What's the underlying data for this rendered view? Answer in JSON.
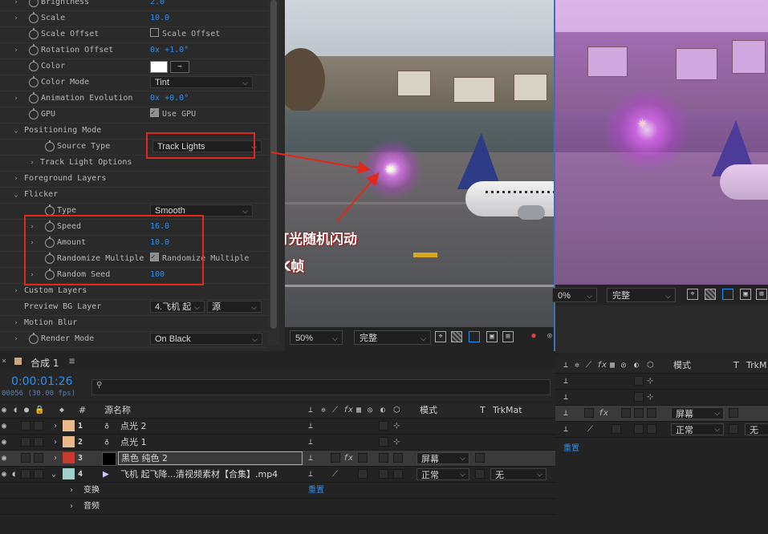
{
  "effect_controls": {
    "properties": [
      {
        "label": "Brightness",
        "value": "2.0",
        "kind": "number"
      },
      {
        "label": "Scale",
        "value": "10.0",
        "kind": "number"
      },
      {
        "label": "Scale Offset",
        "value": "Scale Offset",
        "kind": "checkbox",
        "checked": false
      },
      {
        "label": "Rotation Offset",
        "value_prefix": "0x",
        "value": "+1.0°",
        "kind": "angle"
      },
      {
        "label": "Color",
        "kind": "color",
        "color": "#ffffff"
      },
      {
        "label": "Color Mode",
        "value": "Tint",
        "kind": "dropdown"
      },
      {
        "label": "Animation Evolution",
        "value_prefix": "0x",
        "value": "+0.0°",
        "kind": "angle"
      },
      {
        "label": "GPU",
        "value": "Use GPU",
        "kind": "checkbox",
        "checked": true
      },
      {
        "label": "Positioning Mode",
        "kind": "group"
      },
      {
        "label": "Source Type",
        "value": "Track Lights",
        "kind": "dropdown"
      },
      {
        "label": "Track Light Options",
        "kind": "subgroup"
      },
      {
        "label": "Foreground Layers",
        "kind": "group"
      },
      {
        "label": "Flicker",
        "kind": "group"
      },
      {
        "label": "Type",
        "value": "Smooth",
        "kind": "dropdown"
      },
      {
        "label": "Speed",
        "value": "16.0",
        "kind": "number"
      },
      {
        "label": "Amount",
        "value": "10.0",
        "kind": "number"
      },
      {
        "label": "Randomize Multiple",
        "value": "Randomize Multiple",
        "kind": "checkbox",
        "checked": true
      },
      {
        "label": "Random Seed",
        "value": "100",
        "kind": "number"
      },
      {
        "label": "Custom Layers",
        "kind": "group"
      },
      {
        "label": "Preview BG Layer",
        "value": "4.飞机 起",
        "value2": "源",
        "kind": "dropdown2"
      },
      {
        "label": "Motion Blur",
        "kind": "group"
      },
      {
        "label": "Render Mode",
        "value": "On Black",
        "kind": "dropdown"
      }
    ]
  },
  "annotations": {
    "line1": "可做灯光随机闪动",
    "line2": "无需K帧"
  },
  "viewer": {
    "zoom": "50%",
    "resolution": "完整",
    "zoom2": "0%",
    "resolution2": "完整"
  },
  "timeline": {
    "tab_label": "合成 1",
    "timecode": "0:00:01:26",
    "frame_info": "00056 (30.00 fps)",
    "search_placeholder": "",
    "headers": {
      "num": "#",
      "source_name": "源名称",
      "mode": "模式",
      "t": "T",
      "trkmat": "TrkMat"
    },
    "layers": [
      {
        "num": "1",
        "name": "点光 2",
        "type": "light",
        "color": "#e8b98a",
        "mode": "",
        "trkmat": ""
      },
      {
        "num": "2",
        "name": "点光 1",
        "type": "light",
        "color": "#e8b98a",
        "mode": "",
        "trkmat": ""
      },
      {
        "num": "3",
        "name": "黑色 纯色 2",
        "type": "solid",
        "color": "#c8392e",
        "mode": "屏幕",
        "trkmat": ""
      },
      {
        "num": "4",
        "name": "飞机 起飞降...清视频素材【合集】.mp4",
        "type": "footage",
        "color": "#9fd0cc",
        "mode": "正常",
        "trkmat": "无"
      }
    ],
    "sub_items": [
      "变换",
      "音频"
    ],
    "reset_label": "重置"
  },
  "timeline2": {
    "headers": {
      "mode": "模式",
      "t": "T",
      "trkmat": "TrkM"
    },
    "modes": [
      "屏幕",
      "正常"
    ],
    "trkmat": "无",
    "reset_label": "重置"
  },
  "colors": {
    "accent": "#2b8ff0",
    "annotation_red": "#e0281c",
    "glow": "#d45cf0"
  }
}
